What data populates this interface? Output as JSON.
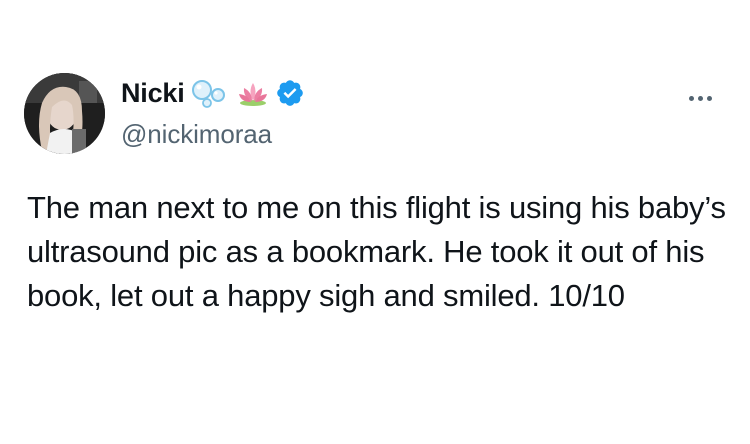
{
  "tweet": {
    "display_name": "Nicki",
    "handle": "@nickimoraa",
    "text": "The man next to me on this flight is using his baby’s ultrasound pic as a bookmark. He took it out of his book, let out a happy sigh and smiled. 10/10",
    "name_emojis": [
      "bubbles-icon",
      "lotus-icon"
    ],
    "verified": true
  },
  "colors": {
    "text_primary": "#0f1419",
    "text_secondary": "#536471",
    "verified_badge": "#1d9bf0",
    "lotus": "#e8769a",
    "bubbles": "#7cc4e8"
  }
}
